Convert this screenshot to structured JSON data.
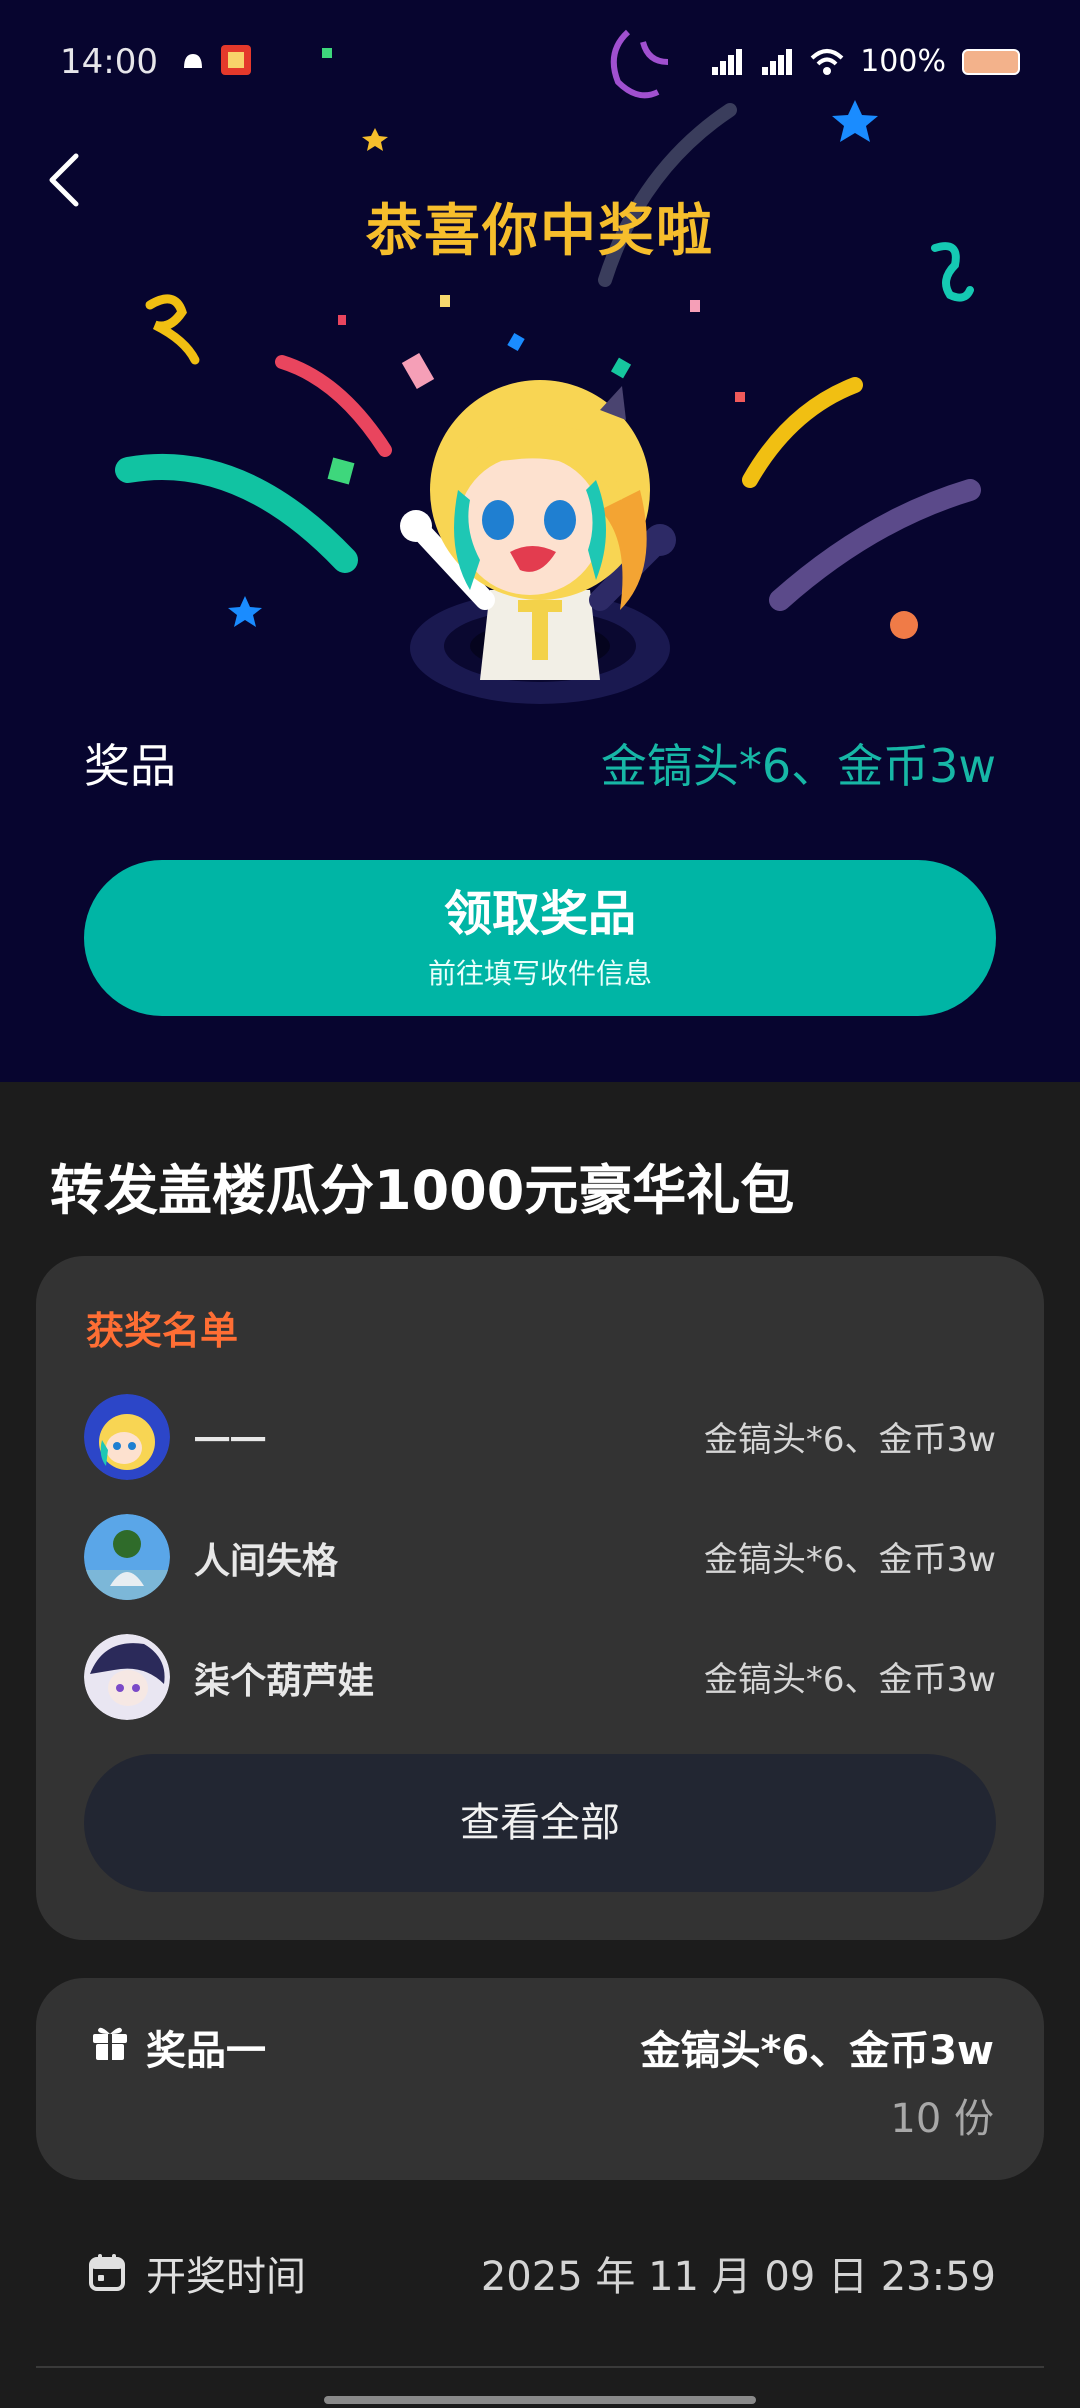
{
  "status_bar": {
    "time": "14:00",
    "battery": "100%"
  },
  "hero": {
    "title": "恭喜你中奖啦",
    "prize_label": "奖品",
    "prize_value": "金镐头*6、金币3w",
    "claim_button": {
      "label": "领取奖品",
      "sub_label": "前往填写收件信息"
    }
  },
  "event": {
    "title": "转发盖楼瓜分1000元豪华礼包"
  },
  "winners": {
    "heading": "获奖名单",
    "rows": [
      {
        "name": "一一",
        "prize": "金镐头*6、金币3w"
      },
      {
        "name": "人间失格",
        "prize": "金镐头*6、金币3w"
      },
      {
        "name": "柒个葫芦娃",
        "prize": "金镐头*6、金币3w"
      }
    ],
    "view_all_label": "查看全部"
  },
  "prize_info": {
    "tier": "奖品一",
    "value": "金镐头*6、金币3w",
    "count": "10 份"
  },
  "draw_time": {
    "label": "开奖时间",
    "value": "2025 年 11 月 09 日 23:59"
  },
  "colors": {
    "hero_background": "#07052f",
    "title_gold": "#f6be2c",
    "accent_teal": "#00b5a5",
    "winners_heading": "#ff6e34",
    "card_background": "#333333",
    "page_background": "#1c1c1c"
  },
  "icons": {
    "back": "chevron-left-icon",
    "gift": "gift-icon",
    "calendar": "calendar-icon"
  }
}
